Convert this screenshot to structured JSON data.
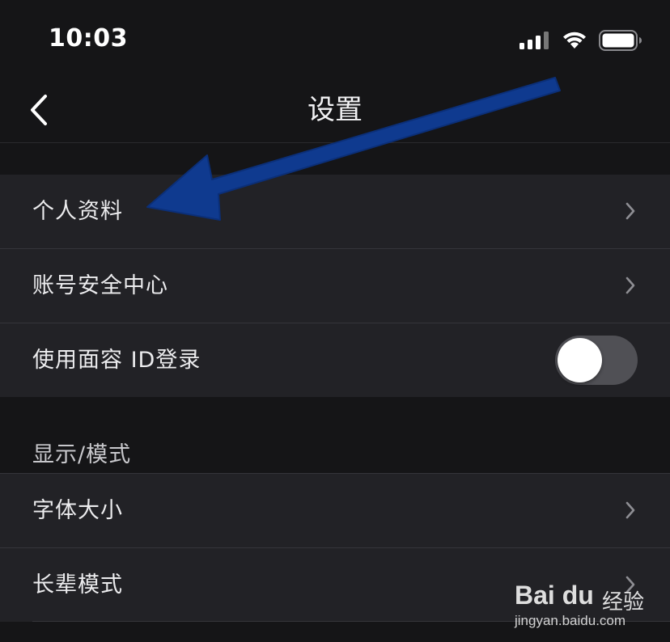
{
  "status_bar": {
    "time": "10:03",
    "icons": [
      "signal-icon",
      "wifi-icon",
      "battery-icon"
    ]
  },
  "nav": {
    "title": "设置",
    "back_icon": "chevron-left-icon"
  },
  "groups": [
    {
      "items": [
        {
          "label": "个人资料",
          "accessory": "chevron"
        },
        {
          "label": "账号安全中心",
          "accessory": "chevron"
        },
        {
          "label": "使用面容 ID登录",
          "accessory": "toggle",
          "toggle_on": false
        }
      ]
    },
    {
      "header": "显示/模式",
      "items": [
        {
          "label": "字体大小",
          "accessory": "chevron"
        },
        {
          "label": "长辈模式",
          "accessory": "chevron"
        }
      ]
    }
  ],
  "annotation": {
    "arrow_color": "#0f3a8f",
    "points_to": "个人资料"
  },
  "watermark": {
    "logo": "Bai du",
    "brand": "经验",
    "url": "jingyan.baidu.com"
  },
  "colors": {
    "background": "#151517",
    "row_background": "#222226",
    "toggle_off": "#505055"
  }
}
